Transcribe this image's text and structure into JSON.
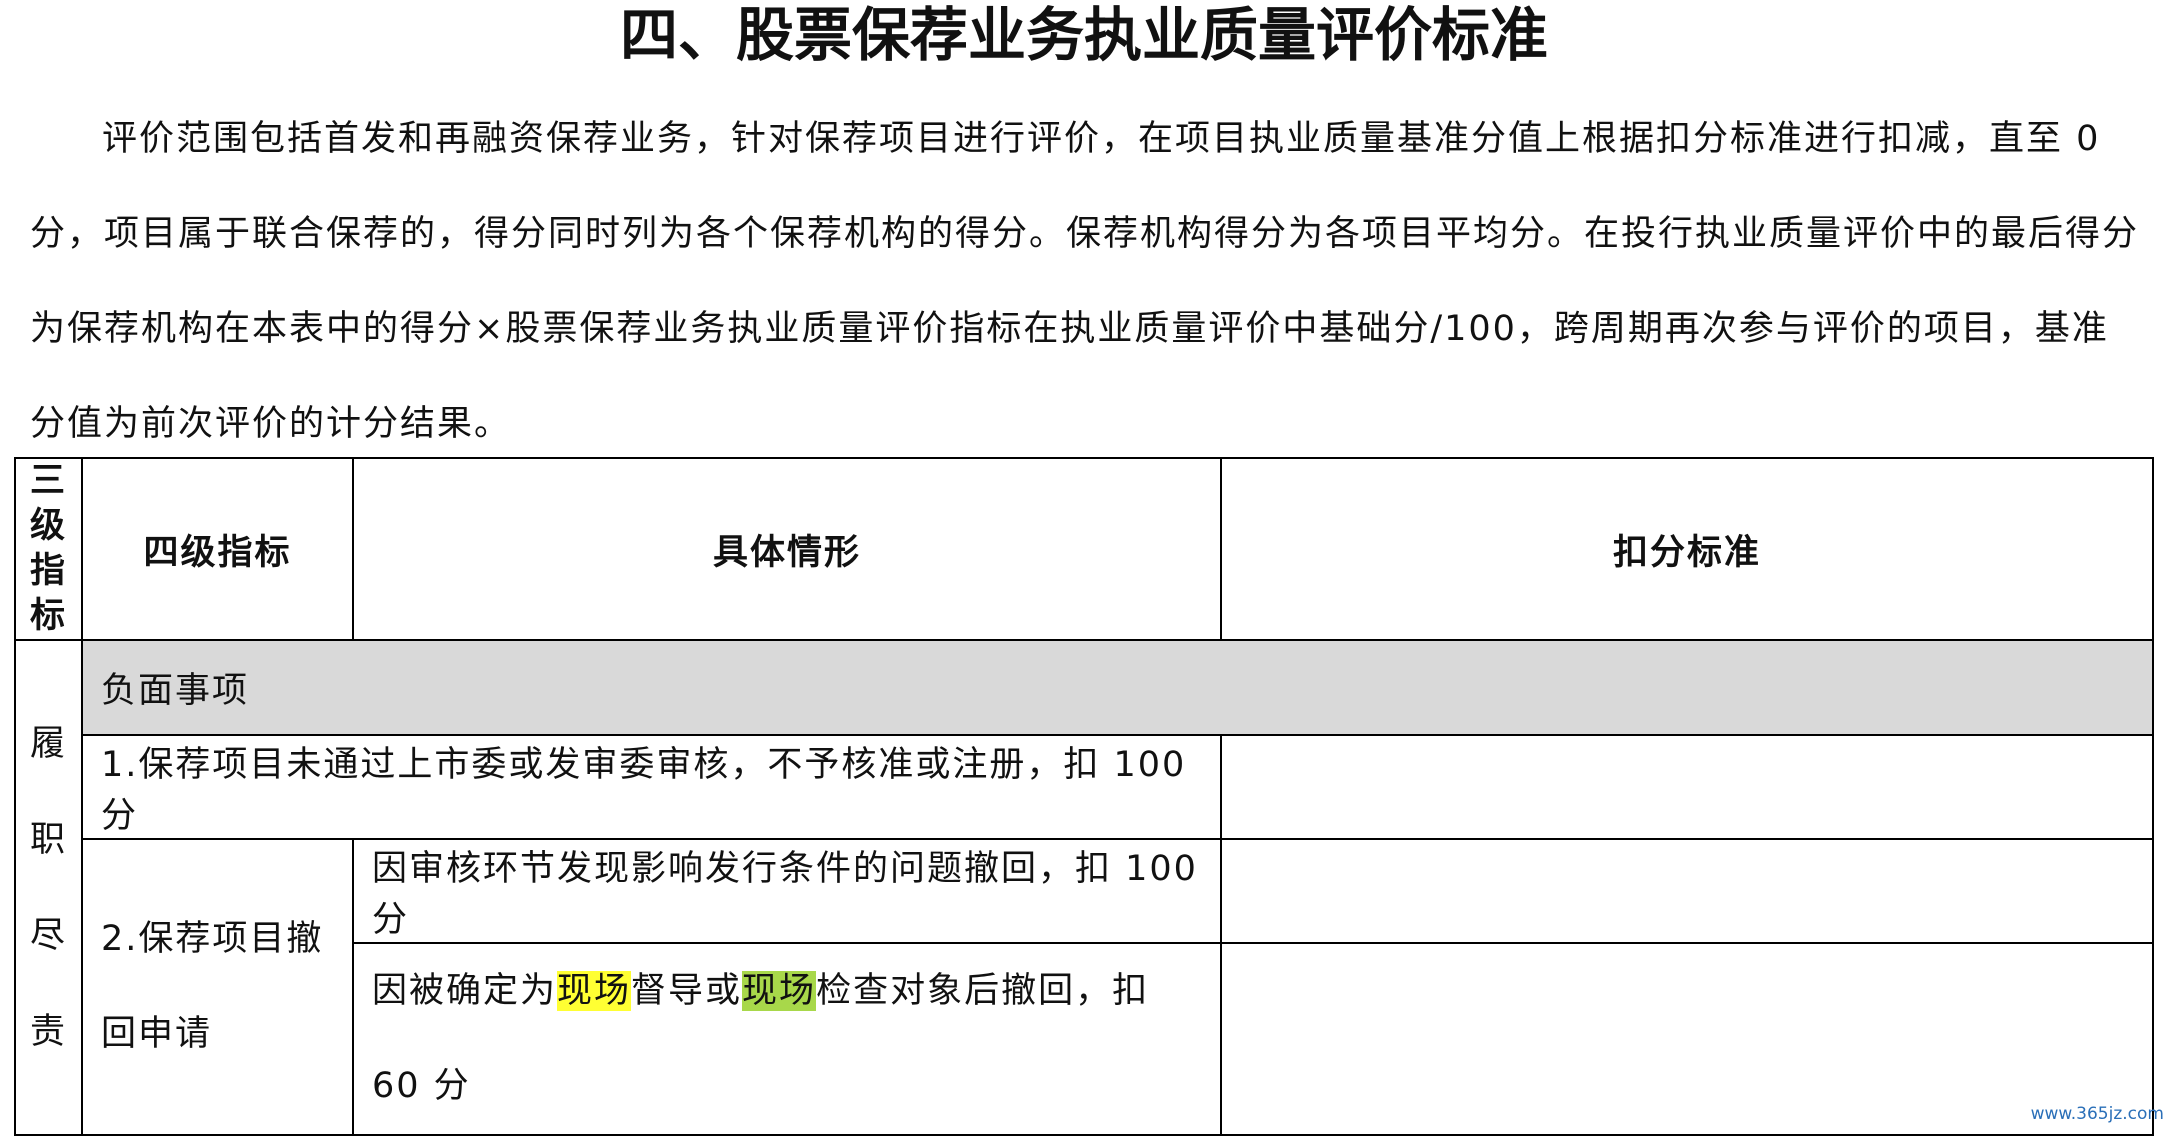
{
  "title": "四、股票保荐业务执业质量评价标准",
  "intro": "评价范围包括首发和再融资保荐业务，针对保荐项目进行评价，在项目执业质量基准分值上根据扣分标准进行扣减，直至 0 分，项目属于联合保荐的，得分同时列为各个保荐机构的得分。保荐机构得分为各项目平均分。在投行执业质量评价中的最后得分为保荐机构在本表中的得分×股票保荐业务执业质量评价指标在执业质量评价中基础分/100，跨周期再次参与评价的项目，基准分值为前次评价的计分结果。",
  "table": {
    "headers": {
      "level3": [
        "三",
        "级",
        "指",
        "标"
      ],
      "level4": "四级指标",
      "situation": "具体情形",
      "deduction": "扣分标准"
    },
    "level3_value": [
      "履",
      "职",
      "尽",
      "责"
    ],
    "negative_section": "负面事项",
    "item1": "1.保荐项目未通过上市委或发审委审核，不予核准或注册，扣 100 分",
    "item2": {
      "label": "2.保荐项目撤回申请",
      "situation1": "因审核环节发现影响发行条件的问题撤回，扣 100 分",
      "situation2": {
        "part1": "因被确定为",
        "highlight1": "现场",
        "part2": "督导或",
        "highlight2": "现场",
        "part3": "检查对象后撤回，扣 60 分"
      }
    }
  },
  "watermark": "www.365jz.com",
  "colors": {
    "negative_row_bg": "#d9d9d9",
    "highlight_yellow": "#ffff33",
    "highlight_green": "#a8d84a"
  }
}
